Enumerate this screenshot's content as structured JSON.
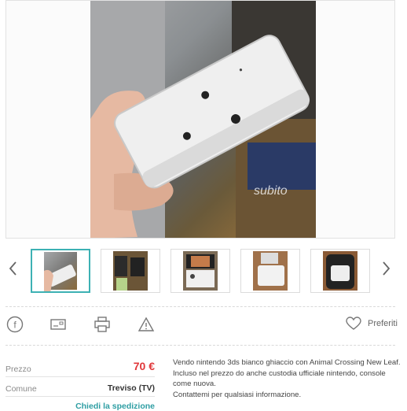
{
  "gallery": {
    "watermark": "subito",
    "thumbnails": [
      {
        "label": "nintendo-3ds-open",
        "active": true
      },
      {
        "label": "3ds-box-and-case",
        "active": false
      },
      {
        "label": "3ds-screen-on",
        "active": false
      },
      {
        "label": "3ds-closed-white",
        "active": false
      },
      {
        "label": "3ds-in-case",
        "active": false
      }
    ],
    "prev_icon": "chevron-left-icon",
    "next_icon": "chevron-right-icon"
  },
  "actions": {
    "icons": [
      "facebook-icon",
      "message-icon",
      "print-icon",
      "warning-icon"
    ],
    "favorite_label": "Preferiti"
  },
  "details": {
    "price_label": "Prezzo",
    "price_value": "70 €",
    "town_label": "Comune",
    "town_value": "Treviso (TV)",
    "shipping_link": "Chiedi la spedizione"
  },
  "description": {
    "line1": "Vendo nintendo 3ds bianco ghiaccio con Animal Crossing New Leaf. Incluso nel prezzo do anche custodia ufficiale nintendo, console come nuova.",
    "line2": "Contattemi per qualsiasi informazione."
  },
  "colors": {
    "accent": "#3db1b4",
    "price": "#e0373a",
    "link": "#2e9ea3"
  }
}
